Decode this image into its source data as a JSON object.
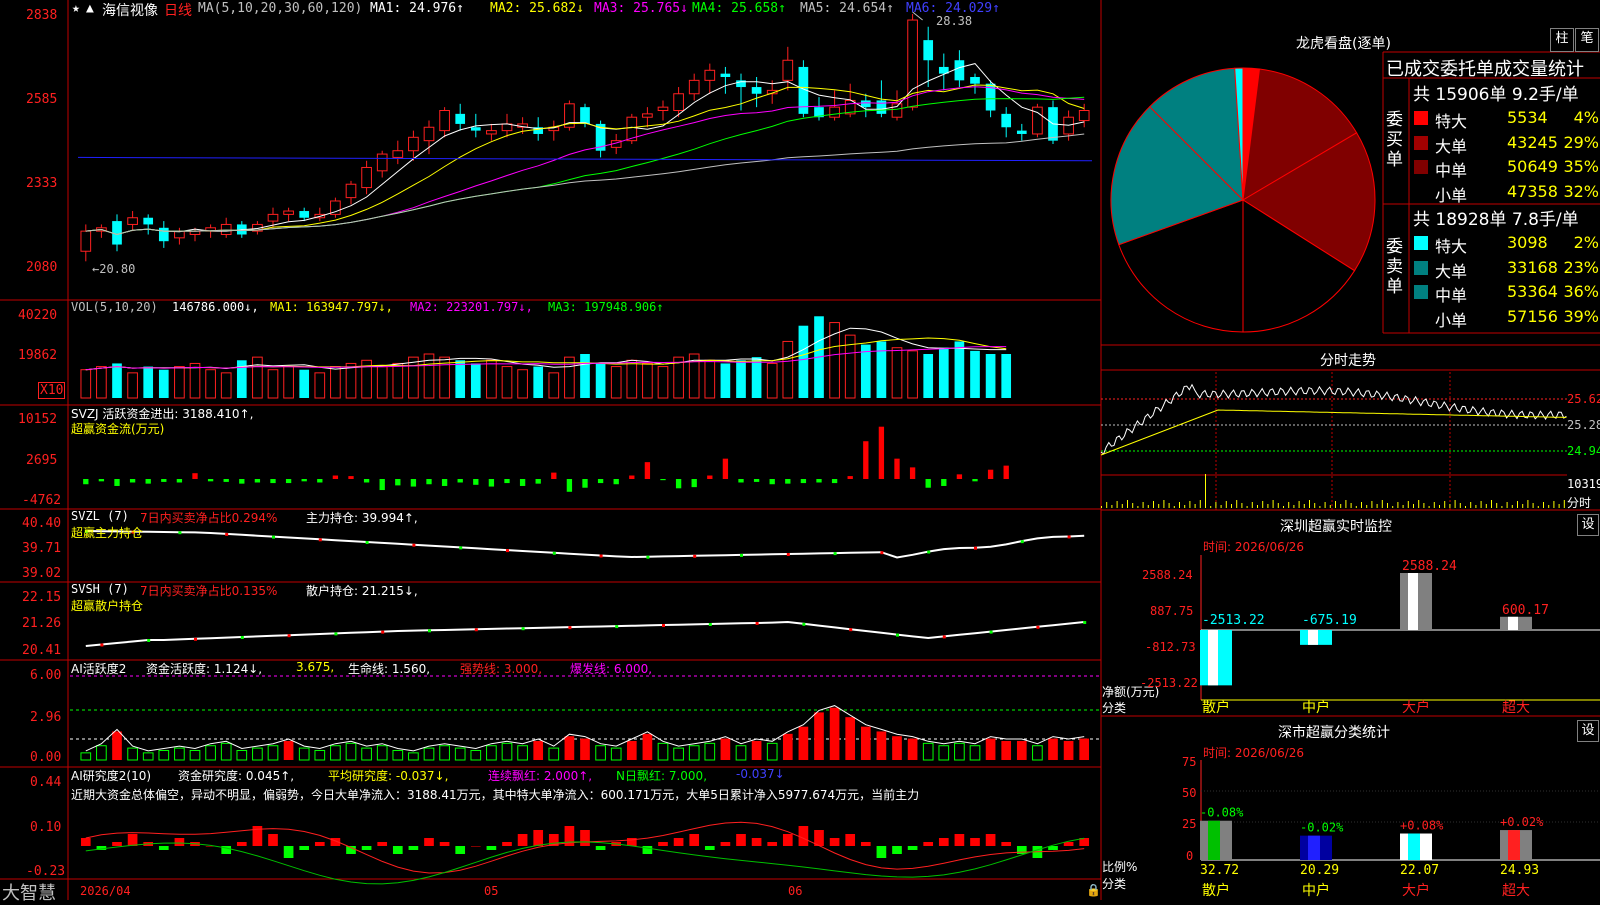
{
  "colors": {
    "up": "#ff2020",
    "down": "#00ffff",
    "border": "#c00000",
    "ma1": "#ffffff",
    "ma2": "#ffff00",
    "ma3": "#ff00ff",
    "ma4": "#00ff00",
    "ma5": "#c0c0c0",
    "ma6": "#2020ff",
    "neg": "#00ff00",
    "pos": "#ff0000",
    "pieBig": "#800000",
    "pieBlue": "#008080"
  },
  "header": {
    "stock": "海信视像",
    "period": "日线",
    "ma_label": "MA(5,10,20,30,60,120)",
    "ma1": "MA1: 24.976↑",
    "ma2": "MA2: 25.682↓",
    "ma3": "MA3: 25.765↓",
    "ma4": "MA4: 25.658↑",
    "ma5": "MA5: 24.654↑",
    "ma6": "MA6: 24.029↑"
  },
  "price_panel": {
    "axis": [
      "2838",
      "2585",
      "2333",
      "2080"
    ],
    "high_label": "28.38",
    "low_label": "←20.80"
  },
  "vol_panel": {
    "title": "VOL(5,10,20)",
    "val": "146786.000↓,",
    "ma1": "MA1: 163947.797↓,",
    "ma2": "MA2: 223201.797↓,",
    "ma3": "MA3: 197948.906↑",
    "axis": [
      "40220",
      "19862"
    ],
    "unit": "X10"
  },
  "svzj_panel": {
    "title": "SVZJ  活跃资金进出: 3188.410↑,",
    "name": "超赢资金流(万元)",
    "axis": [
      "10152",
      "2695",
      "-4762"
    ]
  },
  "svzl_panel": {
    "title": "SVZL (7)",
    "hint": "7日内买卖净占比0.294%",
    "value": "主力持仓: 39.994↑,",
    "name": "超赢主力持仓",
    "axis": [
      "40.40",
      "39.71",
      "39.02"
    ]
  },
  "svsh_panel": {
    "title": "SVSH (7)",
    "hint": "7日内买卖净占比0.135%",
    "value": "散户持仓: 21.215↓,",
    "name": "超赢散户持仓",
    "axis": [
      "22.15",
      "21.26",
      "20.41"
    ]
  },
  "ai1_panel": {
    "title": "AI活跃度2",
    "v1": "资金活跃度: 1.124↓,",
    "v2": "3.675,",
    "v3": "生命线: 1.560,",
    "v4": "强势线: 3.000,",
    "v5": "爆发线: 6.000,",
    "axis": [
      "6.00",
      "2.96",
      "0.00"
    ]
  },
  "ai2_panel": {
    "title": "AI研究度2(10)",
    "v1": "资金研究度: 0.045↑,",
    "v2": "平均研究度: -0.037↓,",
    "v3": "连续飘红: 2.000↑,",
    "v4": "N日飘红: 7.000,",
    "v5": "-0.037↓",
    "desc": "近期大资金总体偏空，异动不明显，偏弱势，今日大单净流入：3188.41万元，其中特大单净流入：600.171万元，大单5日累计净入5977.674万元，当前主力",
    "axis": [
      "0.44",
      "0.10",
      "-0.23"
    ]
  },
  "bottom": {
    "brand": "大智慧",
    "date1": "2026/04",
    "date2": "05",
    "date3": "06"
  },
  "lhk": {
    "title": "龙虎看盘(逐单)",
    "btn1": "柱",
    "btn2": "笔",
    "header": "已成交委托单成交量统计",
    "buy_label": "委买单",
    "sell_label": "委卖单",
    "buy_total": "共 15906单 9.2手/单",
    "sell_total": "共 18928单 7.8手/单",
    "buy_rows": [
      {
        "name": "特大",
        "vol": "5534",
        "pct": "4%",
        "color": "#ff0000"
      },
      {
        "name": "大单",
        "vol": "43245",
        "pct": "29%",
        "color": "#a00000"
      },
      {
        "name": "中单",
        "vol": "50649",
        "pct": "35%",
        "color": "#800000"
      },
      {
        "name": "小单",
        "vol": "47358",
        "pct": "32%",
        "color": "#000000"
      }
    ],
    "sell_rows": [
      {
        "name": "特大",
        "vol": "3098",
        "pct": "2%",
        "color": "#00ffff"
      },
      {
        "name": "大单",
        "vol": "33168",
        "pct": "23%",
        "color": "#008080"
      },
      {
        "name": "中单",
        "vol": "53364",
        "pct": "36%",
        "color": "#008080"
      },
      {
        "name": "小单",
        "vol": "57156",
        "pct": "39%",
        "color": "#000000"
      }
    ]
  },
  "intraday": {
    "title": "分时走势",
    "axis": [
      "25.62",
      "25.28",
      "24.94"
    ],
    "vol_axis": "10319",
    "unit": "分时"
  },
  "monitor": {
    "title": "深圳超赢实时监控",
    "btn": "设",
    "time": "时间: 2026/06/26",
    "ylabel1": "净额(万元)",
    "ylabel2": "分类",
    "axis": [
      "2588.24",
      "887.75",
      "-812.73",
      "-2513.22"
    ]
  },
  "classify": {
    "title": "深市超赢分类统计",
    "btn": "设",
    "time": "时间: 2026/06/26",
    "ylabel1": "比例%",
    "ylabel2": "分类",
    "axis": [
      "75",
      "50",
      "25",
      "0"
    ]
  },
  "chart_data": [
    {
      "type": "candlestick",
      "title": "海信视像 日线",
      "series": [
        {
          "name": "MA1",
          "value": 24.976
        },
        {
          "name": "MA2",
          "value": 25.682
        },
        {
          "name": "MA3",
          "value": 25.765
        },
        {
          "name": "MA4",
          "value": 25.658
        },
        {
          "name": "MA5",
          "value": 24.654
        },
        {
          "name": "MA6",
          "value": 24.029
        }
      ],
      "ylim": [
        20.8,
        28.38
      ],
      "candles": [
        [
          21.3,
          21.9,
          21.0,
          22.1
        ],
        [
          21.9,
          22.0,
          21.7,
          22.1
        ],
        [
          22.2,
          21.5,
          21.3,
          22.4
        ],
        [
          22.1,
          22.3,
          21.9,
          22.5
        ],
        [
          22.3,
          22.1,
          21.8,
          22.4
        ],
        [
          22.0,
          21.6,
          21.4,
          22.2
        ],
        [
          21.7,
          21.9,
          21.5,
          22.0
        ],
        [
          21.8,
          21.9,
          21.6,
          22.0
        ],
        [
          21.9,
          22.0,
          21.7,
          22.1
        ],
        [
          21.8,
          22.1,
          21.7,
          22.3
        ],
        [
          22.1,
          21.8,
          21.7,
          22.2
        ],
        [
          21.9,
          22.1,
          21.8,
          22.2
        ],
        [
          22.2,
          22.4,
          22.0,
          22.6
        ],
        [
          22.4,
          22.5,
          22.2,
          22.6
        ],
        [
          22.5,
          22.3,
          22.2,
          22.6
        ],
        [
          22.3,
          22.4,
          22.2,
          22.6
        ],
        [
          22.4,
          22.8,
          22.3,
          22.9
        ],
        [
          22.9,
          23.3,
          22.7,
          23.4
        ],
        [
          23.2,
          23.8,
          23.0,
          24.0
        ],
        [
          23.7,
          24.2,
          23.5,
          24.3
        ],
        [
          24.1,
          24.3,
          23.9,
          24.6
        ],
        [
          24.3,
          24.7,
          24.0,
          24.9
        ],
        [
          24.6,
          25.0,
          24.2,
          25.2
        ],
        [
          24.9,
          25.5,
          24.7,
          25.6
        ],
        [
          25.4,
          25.1,
          24.9,
          25.7
        ],
        [
          25.0,
          24.9,
          24.7,
          25.4
        ],
        [
          24.8,
          24.9,
          24.6,
          25.1
        ],
        [
          24.9,
          25.1,
          24.7,
          25.4
        ],
        [
          25.0,
          25.1,
          24.8,
          25.3
        ],
        [
          25.0,
          24.8,
          24.6,
          25.3
        ],
        [
          24.9,
          25.0,
          24.6,
          25.2
        ],
        [
          25.0,
          25.7,
          24.9,
          25.8
        ],
        [
          25.6,
          25.1,
          25.0,
          25.7
        ],
        [
          25.1,
          24.3,
          24.1,
          25.2
        ],
        [
          24.4,
          24.6,
          24.2,
          24.8
        ],
        [
          24.6,
          25.3,
          24.5,
          25.4
        ],
        [
          25.3,
          25.4,
          25.0,
          25.6
        ],
        [
          25.5,
          25.6,
          25.2,
          25.8
        ],
        [
          25.5,
          26.0,
          25.3,
          26.2
        ],
        [
          26.0,
          26.4,
          25.8,
          26.6
        ],
        [
          26.4,
          26.7,
          26.0,
          26.9
        ],
        [
          26.6,
          26.5,
          26.0,
          26.8
        ],
        [
          26.4,
          26.2,
          25.5,
          26.6
        ],
        [
          26.2,
          26.0,
          25.6,
          26.5
        ],
        [
          26.0,
          26.1,
          25.7,
          26.4
        ],
        [
          26.4,
          27.0,
          26.1,
          27.4
        ],
        [
          26.8,
          25.4,
          25.3,
          27.0
        ],
        [
          25.6,
          25.3,
          25.2,
          25.9
        ],
        [
          25.3,
          25.6,
          25.2,
          26.1
        ],
        [
          25.4,
          25.8,
          25.3,
          26.3
        ],
        [
          25.8,
          25.6,
          25.3,
          26.0
        ],
        [
          25.8,
          25.4,
          25.3,
          26.4
        ],
        [
          25.3,
          25.7,
          25.2,
          26.1
        ],
        [
          25.6,
          28.2,
          25.5,
          28.38
        ],
        [
          27.6,
          27.0,
          26.2,
          28.0
        ],
        [
          26.8,
          26.6,
          26.1,
          27.2
        ],
        [
          27.0,
          26.4,
          26.2,
          27.3
        ],
        [
          26.5,
          26.3,
          26.0,
          26.6
        ],
        [
          26.3,
          25.5,
          25.3,
          26.4
        ],
        [
          25.4,
          25.0,
          24.7,
          25.6
        ],
        [
          24.9,
          24.8,
          24.6,
          25.1
        ],
        [
          24.8,
          25.6,
          24.7,
          25.7
        ],
        [
          25.6,
          24.6,
          24.5,
          25.8
        ],
        [
          24.8,
          25.3,
          24.6,
          25.5
        ],
        [
          25.2,
          25.5,
          25.0,
          25.7
        ]
      ]
    },
    {
      "type": "bar",
      "title": "VOL(5,10,20)",
      "values": [
        9,
        10,
        11,
        8,
        10,
        9,
        10,
        11,
        9,
        8,
        12,
        13,
        9,
        10,
        9,
        8,
        10,
        11,
        12,
        10,
        11,
        13,
        14,
        13,
        12,
        11,
        12,
        10,
        9,
        10,
        8,
        13,
        14,
        11,
        10,
        12,
        11,
        10,
        13,
        14,
        12,
        11,
        12,
        13,
        11,
        18,
        23,
        26,
        24,
        20,
        17,
        18,
        16,
        15,
        14,
        16,
        18,
        15,
        14,
        14
      ],
      "ylim": [
        0,
        40220
      ]
    },
    {
      "type": "bar",
      "title": "超赢资金流(万元)",
      "values": [
        -900,
        -400,
        -1200,
        -600,
        -800,
        -500,
        -600,
        1000,
        -400,
        -500,
        -800,
        -600,
        -700,
        -700,
        -400,
        -600,
        600,
        500,
        -600,
        -1900,
        -1100,
        -1300,
        -900,
        -1200,
        -600,
        -1000,
        -1300,
        -700,
        -1200,
        -800,
        1100,
        -2200,
        -1500,
        -700,
        -900,
        600,
        2900,
        -200,
        -1600,
        -1400,
        600,
        3500,
        -600,
        -500,
        -900,
        -800,
        -700,
        -600,
        -700,
        500,
        6500,
        9000,
        3500,
        2000,
        -1500,
        -1200,
        800,
        -400,
        1600,
        2300
      ],
      "ylim": [
        -4762,
        10152
      ]
    },
    {
      "type": "line",
      "title": "超赢主力持仓",
      "ylim": [
        39.02,
        40.4
      ]
    },
    {
      "type": "line",
      "title": "超赢散户持仓",
      "ylim": [
        20.41,
        22.15
      ]
    },
    {
      "type": "bar",
      "title": "AI活跃度2",
      "ylim": [
        0,
        6.0
      ]
    },
    {
      "type": "bar",
      "title": "AI研究度2(10)",
      "ylim": [
        -0.23,
        0.44
      ]
    },
    {
      "type": "pie",
      "title": "龙虎看盘(逐单)",
      "values": [
        4,
        29,
        35,
        32,
        39,
        36,
        23,
        2
      ]
    },
    {
      "type": "bar",
      "title": "深圳超赢实时监控",
      "categories": [
        "散户",
        "中户",
        "大户",
        "超大"
      ],
      "values": [
        -2513.22,
        -675.19,
        2588.24,
        600.17
      ],
      "ylim": [
        -2513.22,
        2588.24
      ]
    },
    {
      "type": "bar",
      "title": "深市超赢分类统计",
      "categories": [
        "散户",
        "中户",
        "大户",
        "超大"
      ],
      "values": [
        32.72,
        20.29,
        22.07,
        24.93
      ],
      "changes": [
        "-0.08%",
        "-0.02%",
        "+0.08%",
        "+0.02%"
      ],
      "ylim": [
        0,
        75
      ]
    }
  ]
}
